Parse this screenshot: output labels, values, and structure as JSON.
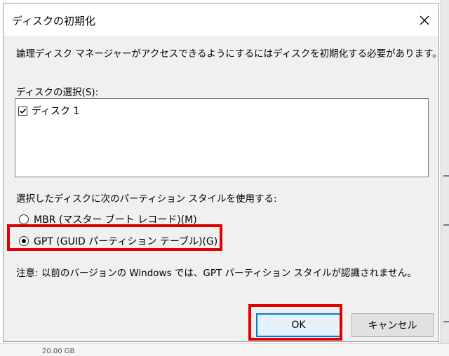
{
  "dialog": {
    "title": "ディスクの初期化",
    "description": "論理ディスク マネージャーがアクセスできるようにするにはディスクを初期化する必要があります。",
    "disk_select_label": "ディスクの選択(S):",
    "disks": [
      {
        "label": "ディスク 1",
        "checked": true
      }
    ],
    "partition_style_label": "選択したディスクに次のパーティション スタイルを使用する:",
    "options": [
      {
        "label": "MBR (マスター ブート レコード)(M)",
        "selected": false
      },
      {
        "label": "GPT (GUID パーティション テーブル)(G)",
        "selected": true
      }
    ],
    "note": "注意: 以前のバージョンの Windows では、GPT パーティション スタイルが認識されません。",
    "ok_label": "OK",
    "cancel_label": "キャンセル"
  },
  "background": {
    "bottom_text": "20.00 GB"
  },
  "colors": {
    "highlight": "#e00000",
    "dialog_bg": "#f0f0f0",
    "default_button_border": "#0078d7"
  },
  "icons": {
    "close": "close-icon",
    "checkbox": "checkbox-checked-icon"
  }
}
